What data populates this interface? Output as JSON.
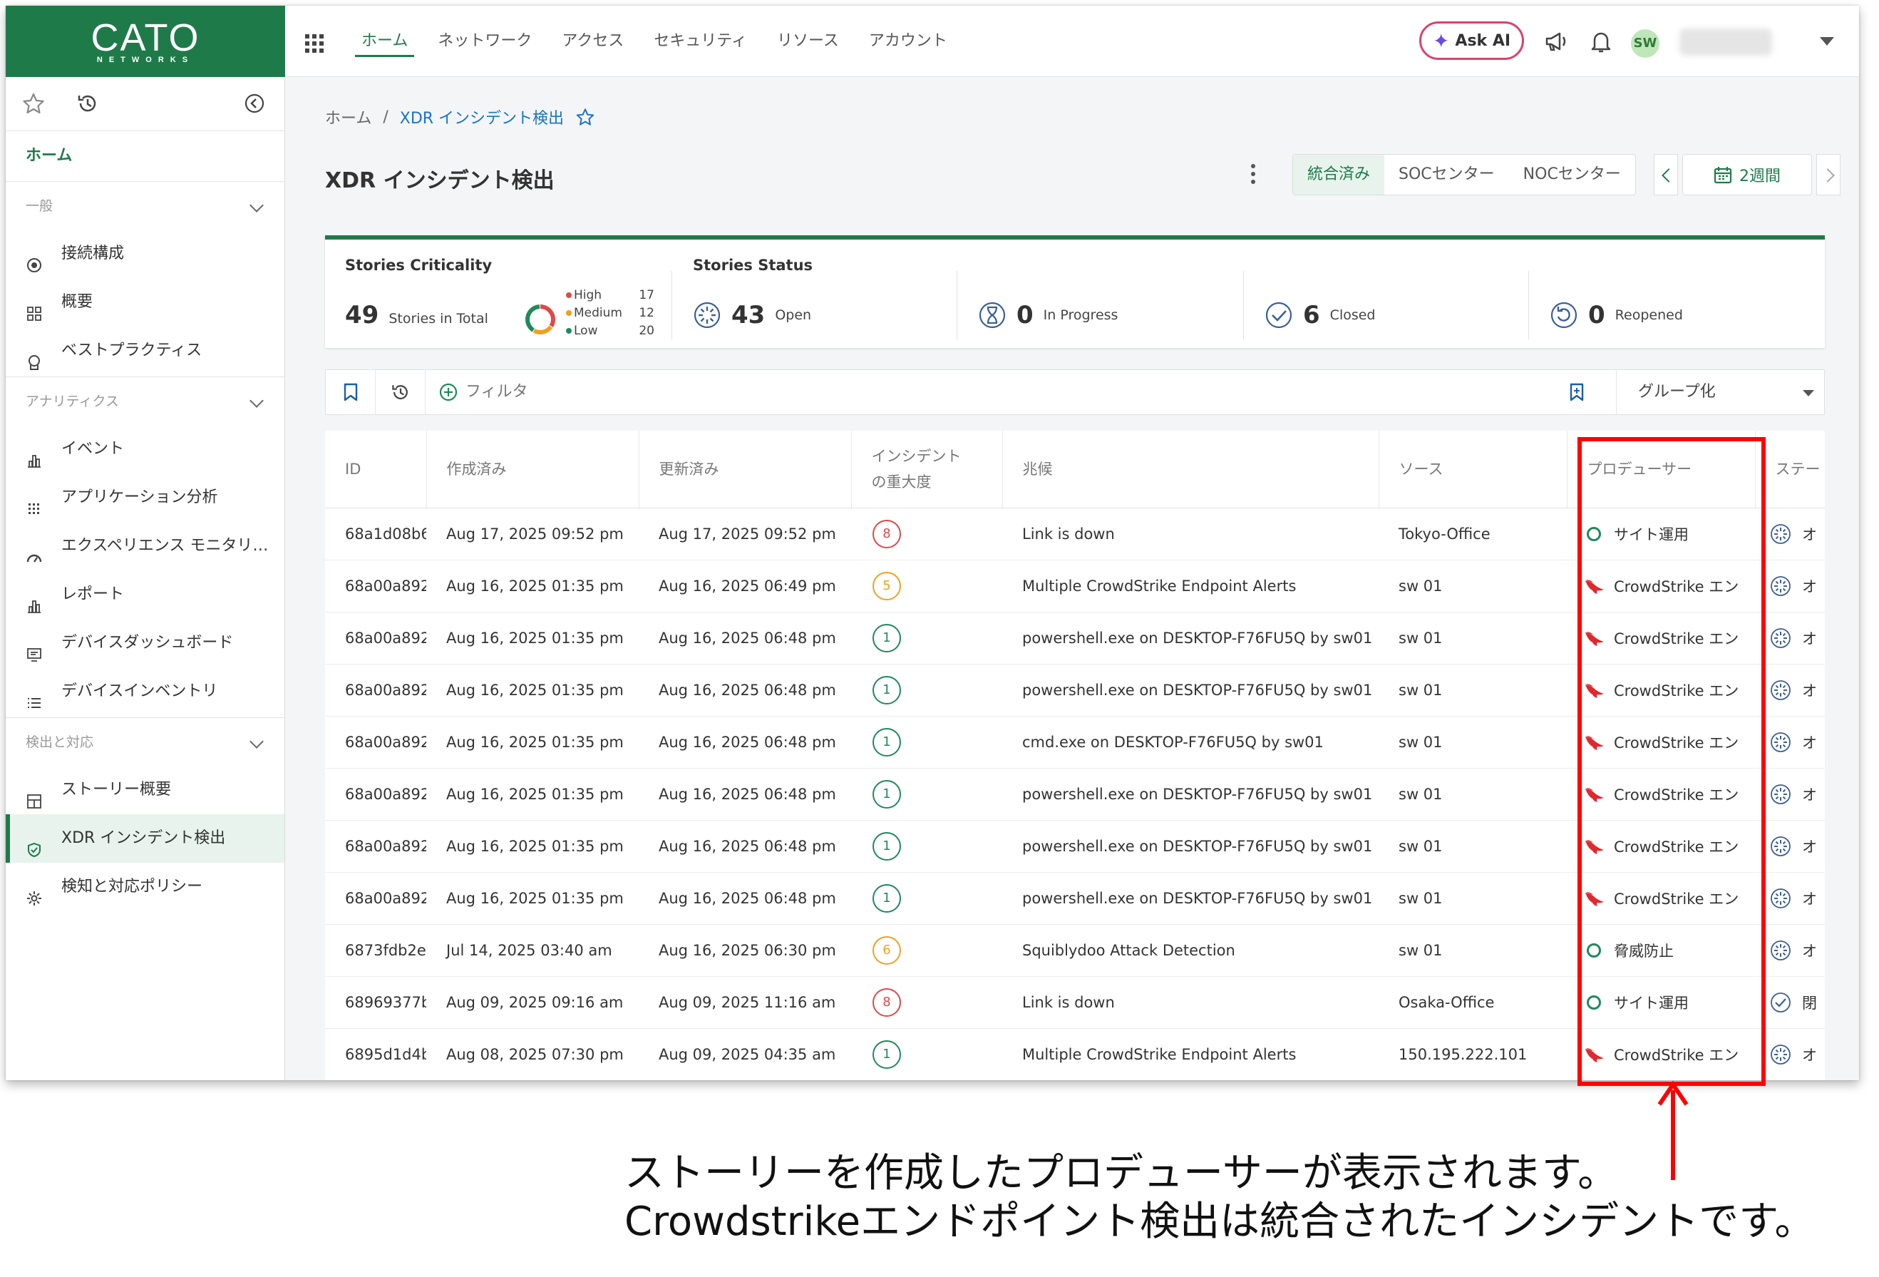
{
  "logo": {
    "word": "CATO",
    "sub": "NETWORKS"
  },
  "nav": {
    "items": [
      "ホーム",
      "ネットワーク",
      "アクセス",
      "セキュリティ",
      "リソース",
      "アカウント"
    ],
    "active_index": 0
  },
  "topbar": {
    "ask_ai": "Ask AI",
    "avatar": "SW"
  },
  "sidebar": {
    "home": "ホーム",
    "groups": [
      {
        "label": "一般",
        "items": [
          {
            "label": "接続構成",
            "icon": "connection-icon"
          },
          {
            "label": "概要",
            "icon": "grid-icon"
          },
          {
            "label": "ベストプラクティス",
            "icon": "badge-icon"
          }
        ]
      },
      {
        "label": "アナリティクス",
        "items": [
          {
            "label": "イベント",
            "icon": "bar-chart-icon"
          },
          {
            "label": "アプリケーション分析",
            "icon": "dots-grid-icon"
          },
          {
            "label": "エクスペリエンス モニタリ…",
            "icon": "gauge-icon"
          },
          {
            "label": "レポート",
            "icon": "bar-chart-icon"
          },
          {
            "label": "デバイスダッシュボード",
            "icon": "monitor-icon"
          },
          {
            "label": "デバイスインベントリ",
            "icon": "list-icon"
          }
        ]
      },
      {
        "label": "検出と対応",
        "items": [
          {
            "label": "ストーリー概要",
            "icon": "layout-icon"
          },
          {
            "label": "XDR インシデント検出",
            "icon": "shield-check-icon",
            "active": true
          },
          {
            "label": "検知と対応ポリシー",
            "icon": "gear-icon"
          }
        ]
      }
    ]
  },
  "breadcrumb": {
    "home": "ホーム",
    "separator": "/",
    "current": "XDR インシデント検出"
  },
  "page": {
    "title": "XDR インシデント検出"
  },
  "view_tabs": [
    "統合済み",
    "SOCセンター",
    "NOCセンター"
  ],
  "view_tabs_active": 0,
  "date_range": "2週間",
  "summary": {
    "criticality_title": "Stories Criticality",
    "total": "49",
    "total_label": "Stories in Total",
    "legend": [
      {
        "label": "High",
        "value": "17",
        "color": "#e04848"
      },
      {
        "label": "Medium",
        "value": "12",
        "color": "#f0a020"
      },
      {
        "label": "Low",
        "value": "20",
        "color": "#1f8a5a"
      }
    ],
    "status_title": "Stories Status",
    "status": [
      {
        "value": "43",
        "label": "Open"
      },
      {
        "value": "0",
        "label": "In Progress"
      },
      {
        "value": "6",
        "label": "Closed"
      },
      {
        "value": "0",
        "label": "Reopened"
      }
    ]
  },
  "filterbar": {
    "filter_label": "フィルタ",
    "group_by": "グループ化"
  },
  "table": {
    "headers": [
      "ID",
      "作成済み",
      "更新済み",
      "インシデント\nの重大度",
      "兆候",
      "ソース",
      "プロデューサー",
      "ステー"
    ],
    "rows": [
      {
        "id": "68a1d08b6",
        "created": "Aug 17, 2025 09:52 pm",
        "updated": "Aug 17, 2025 09:52 pm",
        "sev": "8",
        "sev_color": "red",
        "sign": "Link is down",
        "source": "Tokyo-Office",
        "producer": "サイト運用",
        "producer_type": "ring",
        "status": "オ",
        "status_icon": "open"
      },
      {
        "id": "68a00a892",
        "created": "Aug 16, 2025 01:35 pm",
        "updated": "Aug 16, 2025 06:49 pm",
        "sev": "5",
        "sev_color": "orange",
        "sign": "Multiple CrowdStrike Endpoint Alerts",
        "source": "sw 01",
        "producer": "CrowdStrike エン",
        "producer_type": "falcon",
        "status": "オ",
        "status_icon": "open"
      },
      {
        "id": "68a00a892",
        "created": "Aug 16, 2025 01:35 pm",
        "updated": "Aug 16, 2025 06:48 pm",
        "sev": "1",
        "sev_color": "green",
        "sign": "powershell.exe on DESKTOP-F76FU5Q by sw01",
        "source": "sw 01",
        "producer": "CrowdStrike エン",
        "producer_type": "falcon",
        "status": "オ",
        "status_icon": "open"
      },
      {
        "id": "68a00a892",
        "created": "Aug 16, 2025 01:35 pm",
        "updated": "Aug 16, 2025 06:48 pm",
        "sev": "1",
        "sev_color": "green",
        "sign": "powershell.exe on DESKTOP-F76FU5Q by sw01",
        "source": "sw 01",
        "producer": "CrowdStrike エン",
        "producer_type": "falcon",
        "status": "オ",
        "status_icon": "open"
      },
      {
        "id": "68a00a892",
        "created": "Aug 16, 2025 01:35 pm",
        "updated": "Aug 16, 2025 06:48 pm",
        "sev": "1",
        "sev_color": "green",
        "sign": "cmd.exe on DESKTOP-F76FU5Q by sw01",
        "source": "sw 01",
        "producer": "CrowdStrike エン",
        "producer_type": "falcon",
        "status": "オ",
        "status_icon": "open"
      },
      {
        "id": "68a00a892",
        "created": "Aug 16, 2025 01:35 pm",
        "updated": "Aug 16, 2025 06:48 pm",
        "sev": "1",
        "sev_color": "green",
        "sign": "powershell.exe on DESKTOP-F76FU5Q by sw01",
        "source": "sw 01",
        "producer": "CrowdStrike エン",
        "producer_type": "falcon",
        "status": "オ",
        "status_icon": "open"
      },
      {
        "id": "68a00a892",
        "created": "Aug 16, 2025 01:35 pm",
        "updated": "Aug 16, 2025 06:48 pm",
        "sev": "1",
        "sev_color": "green",
        "sign": "powershell.exe on DESKTOP-F76FU5Q by sw01",
        "source": "sw 01",
        "producer": "CrowdStrike エン",
        "producer_type": "falcon",
        "status": "オ",
        "status_icon": "open"
      },
      {
        "id": "68a00a892",
        "created": "Aug 16, 2025 01:35 pm",
        "updated": "Aug 16, 2025 06:48 pm",
        "sev": "1",
        "sev_color": "green",
        "sign": "powershell.exe on DESKTOP-F76FU5Q by sw01",
        "source": "sw 01",
        "producer": "CrowdStrike エン",
        "producer_type": "falcon",
        "status": "オ",
        "status_icon": "open"
      },
      {
        "id": "6873fdb2e",
        "created": "Jul 14, 2025 03:40 am",
        "updated": "Aug 16, 2025 06:30 pm",
        "sev": "6",
        "sev_color": "orange",
        "sign": "Squiblydoo Attack Detection",
        "source": "sw 01",
        "producer": "脅威防止",
        "producer_type": "ring",
        "status": "オ",
        "status_icon": "open"
      },
      {
        "id": "68969377b",
        "created": "Aug 09, 2025 09:16 am",
        "updated": "Aug 09, 2025 11:16 am",
        "sev": "8",
        "sev_color": "red",
        "sign": "Link is down",
        "source": "Osaka-Office",
        "producer": "サイト運用",
        "producer_type": "ring",
        "status": "閉",
        "status_icon": "closed"
      },
      {
        "id": "6895d1d4b",
        "created": "Aug 08, 2025 07:30 pm",
        "updated": "Aug 09, 2025 04:35 am",
        "sev": "1",
        "sev_color": "green",
        "sign": "Multiple CrowdStrike Endpoint Alerts",
        "source": "150.195.222.101",
        "producer": "CrowdStrike エン",
        "producer_type": "falcon",
        "status": "オ",
        "status_icon": "open"
      }
    ]
  },
  "annotation": {
    "line1": "ストーリーを作成したプロデューサーが表示されます。",
    "line2": "Crowdstrikeエンドポイント検出は統合されたインシデントです。",
    "color": "#ff0000"
  }
}
